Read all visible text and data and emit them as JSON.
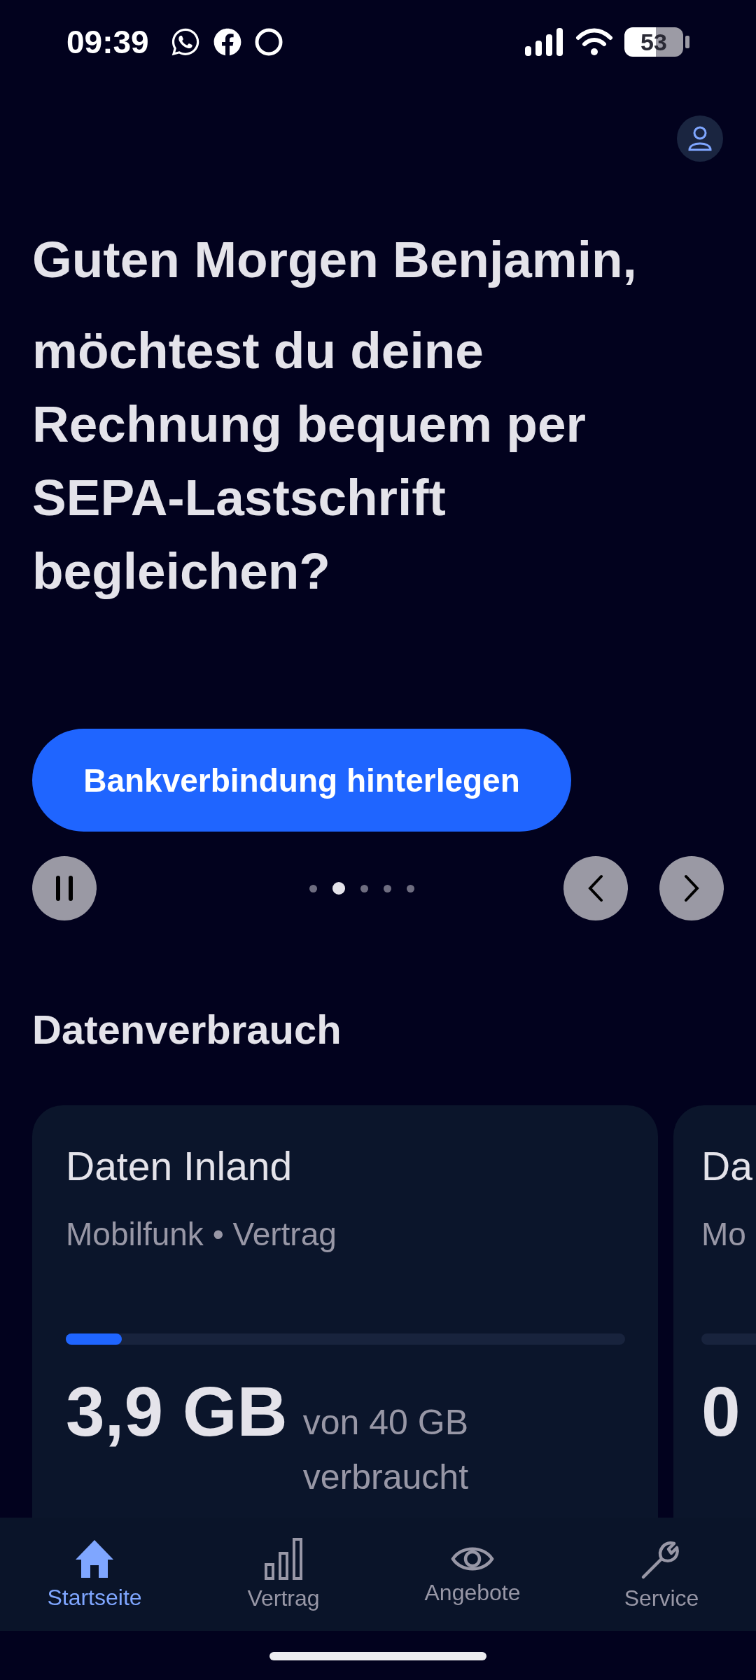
{
  "status_bar": {
    "time": "09:39",
    "battery": "53"
  },
  "headline": {
    "greeting": "Guten Morgen Benjamin,",
    "question": "möchtest du deine Rechnung bequem per SEPA-Lastschrift begleichen?"
  },
  "cta_button": "Bankverbindung hinterlegen",
  "carousel": {
    "dots": [
      {
        "selected": false
      },
      {
        "selected": true
      },
      {
        "selected": false
      },
      {
        "selected": false
      },
      {
        "selected": false
      }
    ]
  },
  "section_title": "Datenverbrauch",
  "usage_cards": [
    {
      "title": "Daten Inland",
      "subtitle": "Mobilfunk • Vertrag",
      "level": 0.1,
      "value": "3,9 GB",
      "detail": "von 40 GB verbraucht"
    },
    {
      "title": "Da",
      "subtitle": "Mo",
      "value": "0"
    }
  ],
  "tab_bar": [
    {
      "label": "Startseite",
      "selected": true
    },
    {
      "label": "Vertrag",
      "selected": false
    },
    {
      "label": "Angebote",
      "selected": false
    },
    {
      "label": "Service",
      "selected": false
    }
  ]
}
